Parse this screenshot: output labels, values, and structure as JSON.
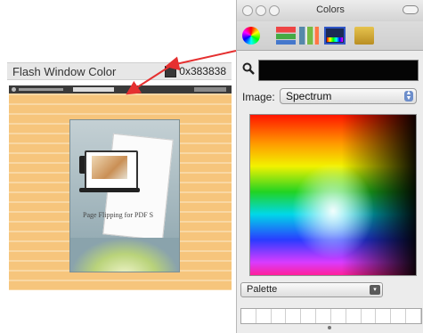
{
  "setting": {
    "label": "Flash Window Color",
    "value": "0x383838",
    "swatch_color": "#383838"
  },
  "preview": {
    "book_caption": "Page Flipping for PDF S"
  },
  "colors_panel": {
    "title": "Colors",
    "toolbar": [
      "color-wheel",
      "color-sliders",
      "color-palettes",
      "image-palettes",
      "crayons"
    ],
    "selected_color": "#050505",
    "image_label": "Image:",
    "image_selected": "Spectrum",
    "palette_selected": "Palette",
    "swatch_count": 12
  },
  "arrow_color": "#e53030"
}
